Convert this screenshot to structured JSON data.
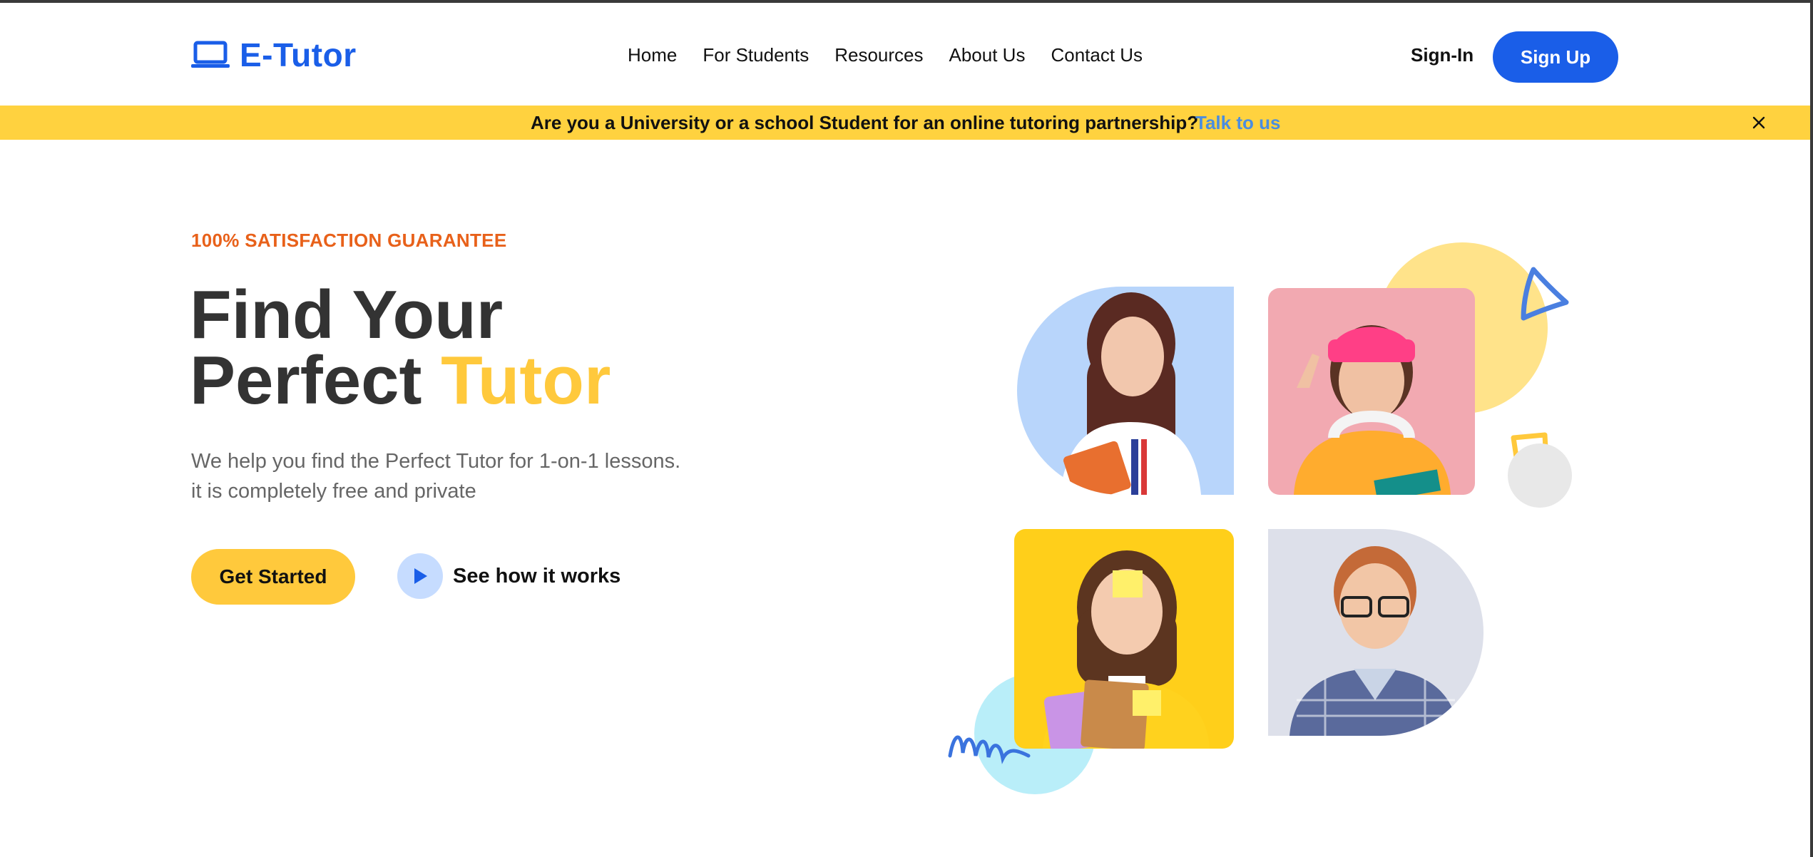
{
  "brand": {
    "name": "E-Tutor",
    "color": "#1a5ee8",
    "icon": "laptop-icon"
  },
  "nav": {
    "items": [
      {
        "label": "Home"
      },
      {
        "label": "For Students"
      },
      {
        "label": "Resources"
      },
      {
        "label": "About Us"
      },
      {
        "label": "Contact Us"
      }
    ],
    "sign_in": "Sign-In",
    "sign_up": "Sign Up"
  },
  "banner": {
    "text": "Are you a University or a school Student for an online tutoring partnership?",
    "link": "Talk to us",
    "close_icon": "close-icon",
    "background": "#ffd23f"
  },
  "hero": {
    "eyebrow": "100% SATISFACTION GUARANTEE",
    "title_line1": "Find Your",
    "title_line2_prefix": "Perfect ",
    "title_line2_accent": "Tutor",
    "description_line1": "We help you find the Perfect Tutor for 1-on-1 lessons.",
    "description_line2": "it is completely free and private",
    "cta_primary": "Get Started",
    "cta_secondary": "See how it works",
    "play_icon": "play-icon"
  },
  "colors": {
    "accent_yellow": "#ffc93c",
    "accent_orange": "#e8611a",
    "primary_blue": "#1a5ee8",
    "heading": "#333333",
    "body_text": "#666666"
  }
}
